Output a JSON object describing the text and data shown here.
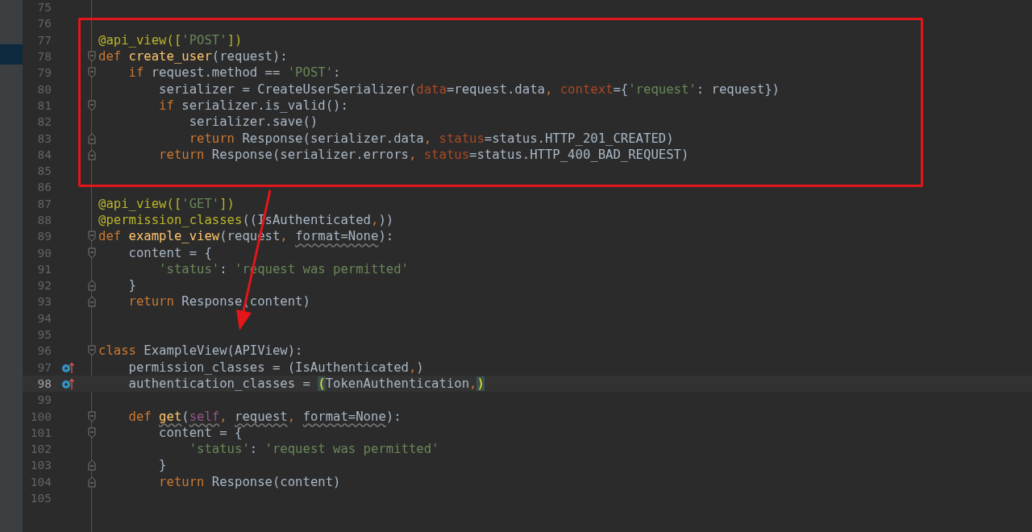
{
  "sidebar": {
    "rows": [
      {
        "selected": false
      },
      {
        "selected": false
      },
      {
        "selected": true
      }
    ]
  },
  "lines": [
    {
      "number": "75"
    },
    {
      "number": "76"
    },
    {
      "number": "77",
      "tokens": [
        {
          "kind": "decorator",
          "text": "@api_view(["
        },
        {
          "kind": "string",
          "text": "'POST'"
        },
        {
          "kind": "decorator",
          "text": "])"
        }
      ]
    },
    {
      "number": "78",
      "fold_start": true,
      "tokens": [
        {
          "kind": "keyword",
          "text": "def "
        },
        {
          "kind": "function",
          "text": "create_user"
        },
        {
          "kind": "plain",
          "text": "(request):"
        }
      ]
    },
    {
      "number": "79",
      "fold_start": true,
      "tokens": [
        {
          "kind": "keyword",
          "text": "    if "
        },
        {
          "kind": "plain",
          "text": "request.method == "
        },
        {
          "kind": "string",
          "text": "'POST'"
        },
        {
          "kind": "plain",
          "text": ":"
        }
      ]
    },
    {
      "number": "80",
      "tokens": [
        {
          "kind": "plain",
          "text": "        serializer = CreateUserSerializer("
        },
        {
          "kind": "param",
          "text": "data"
        },
        {
          "kind": "plain",
          "text": "=request.data"
        },
        {
          "kind": "keyword",
          "text": ", "
        },
        {
          "kind": "param",
          "text": "context"
        },
        {
          "kind": "plain",
          "text": "={"
        },
        {
          "kind": "string",
          "text": "'request'"
        },
        {
          "kind": "plain",
          "text": ": request})"
        }
      ]
    },
    {
      "number": "81",
      "fold_start": true,
      "tokens": [
        {
          "kind": "keyword",
          "text": "        if "
        },
        {
          "kind": "plain",
          "text": "serializer.is_valid():"
        }
      ]
    },
    {
      "number": "82",
      "tokens": [
        {
          "kind": "plain",
          "text": "            serializer.save()"
        }
      ]
    },
    {
      "number": "83",
      "fold_end": true,
      "tokens": [
        {
          "kind": "keyword",
          "text": "            return "
        },
        {
          "kind": "plain",
          "text": "Response(serializer.data"
        },
        {
          "kind": "keyword",
          "text": ", "
        },
        {
          "kind": "param",
          "text": "status"
        },
        {
          "kind": "plain",
          "text": "=status.HTTP_201_CREATED)"
        }
      ]
    },
    {
      "number": "84",
      "fold_end": true,
      "tokens": [
        {
          "kind": "keyword",
          "text": "        return "
        },
        {
          "kind": "plain",
          "text": "Response(serializer.errors"
        },
        {
          "kind": "keyword",
          "text": ", "
        },
        {
          "kind": "param",
          "text": "status"
        },
        {
          "kind": "plain",
          "text": "=status.HTTP_400_BAD_REQUEST)"
        }
      ]
    },
    {
      "number": "85"
    },
    {
      "number": "86"
    },
    {
      "number": "87",
      "tokens": [
        {
          "kind": "decorator",
          "text": "@api_view(["
        },
        {
          "kind": "string",
          "text": "'GET'"
        },
        {
          "kind": "decorator",
          "text": "])"
        }
      ]
    },
    {
      "number": "88",
      "tokens": [
        {
          "kind": "decorator",
          "text": "@permission_classes"
        },
        {
          "kind": "plain",
          "text": "((IsAuthenticated"
        },
        {
          "kind": "keyword",
          "text": ","
        },
        {
          "kind": "plain",
          "text": "))"
        }
      ]
    },
    {
      "number": "89",
      "fold_start": true,
      "tokens": [
        {
          "kind": "keyword",
          "text": "def "
        },
        {
          "kind": "function",
          "text": "example_view"
        },
        {
          "kind": "plain",
          "text": "(request"
        },
        {
          "kind": "keyword",
          "text": ", "
        },
        {
          "kind": "warn",
          "text": "format=None"
        },
        {
          "kind": "plain",
          "text": "):"
        }
      ]
    },
    {
      "number": "90",
      "fold_start": true,
      "tokens": [
        {
          "kind": "plain",
          "text": "    content = {"
        }
      ]
    },
    {
      "number": "91",
      "tokens": [
        {
          "kind": "string",
          "text": "        'status'"
        },
        {
          "kind": "plain",
          "text": ": "
        },
        {
          "kind": "string",
          "text": "'request was permitted'"
        }
      ]
    },
    {
      "number": "92",
      "fold_end": true,
      "tokens": [
        {
          "kind": "plain",
          "text": "    }"
        }
      ]
    },
    {
      "number": "93",
      "fold_end": true,
      "tokens": [
        {
          "kind": "keyword",
          "text": "    return "
        },
        {
          "kind": "plain",
          "text": "Response(content)"
        }
      ]
    },
    {
      "number": "94"
    },
    {
      "number": "95"
    },
    {
      "number": "96",
      "fold_start": true,
      "tokens": [
        {
          "kind": "keyword",
          "text": "class "
        },
        {
          "kind": "plain",
          "text": "ExampleView(APIView):"
        }
      ]
    },
    {
      "number": "97",
      "override": true,
      "tokens": [
        {
          "kind": "plain",
          "text": "    permission_classes = (IsAuthenticated"
        },
        {
          "kind": "keyword",
          "text": ","
        },
        {
          "kind": "plain",
          "text": ")"
        }
      ]
    },
    {
      "number": "98",
      "override": true,
      "current": true,
      "tokens": [
        {
          "kind": "plain",
          "text": "    authentication_classes = "
        },
        {
          "kind": "match",
          "text": "("
        },
        {
          "kind": "plain",
          "text": "TokenAuthentication"
        },
        {
          "kind": "keyword",
          "text": ","
        },
        {
          "kind": "match",
          "text": ")"
        }
      ]
    },
    {
      "number": "99"
    },
    {
      "number": "100",
      "fold_start": true,
      "tokens": [
        {
          "kind": "keyword",
          "text": "    def "
        },
        {
          "kind": "function-warn",
          "text": "get"
        },
        {
          "kind": "plain",
          "text": "("
        },
        {
          "kind": "self",
          "text": "self"
        },
        {
          "kind": "keyword",
          "text": ", "
        },
        {
          "kind": "warn",
          "text": "request"
        },
        {
          "kind": "keyword",
          "text": ", "
        },
        {
          "kind": "warn",
          "text": "format=None"
        },
        {
          "kind": "plain",
          "text": "):"
        }
      ]
    },
    {
      "number": "101",
      "fold_start": true,
      "tokens": [
        {
          "kind": "plain",
          "text": "        content = {"
        }
      ]
    },
    {
      "number": "102",
      "tokens": [
        {
          "kind": "string",
          "text": "            'status'"
        },
        {
          "kind": "plain",
          "text": ": "
        },
        {
          "kind": "string",
          "text": "'request was permitted'"
        }
      ]
    },
    {
      "number": "103",
      "fold_end": true,
      "tokens": [
        {
          "kind": "plain",
          "text": "        }"
        }
      ]
    },
    {
      "number": "104",
      "fold_end": true,
      "tokens": [
        {
          "kind": "keyword",
          "text": "        return "
        },
        {
          "kind": "plain",
          "text": "Response(content)"
        }
      ]
    },
    {
      "number": "105"
    }
  ]
}
